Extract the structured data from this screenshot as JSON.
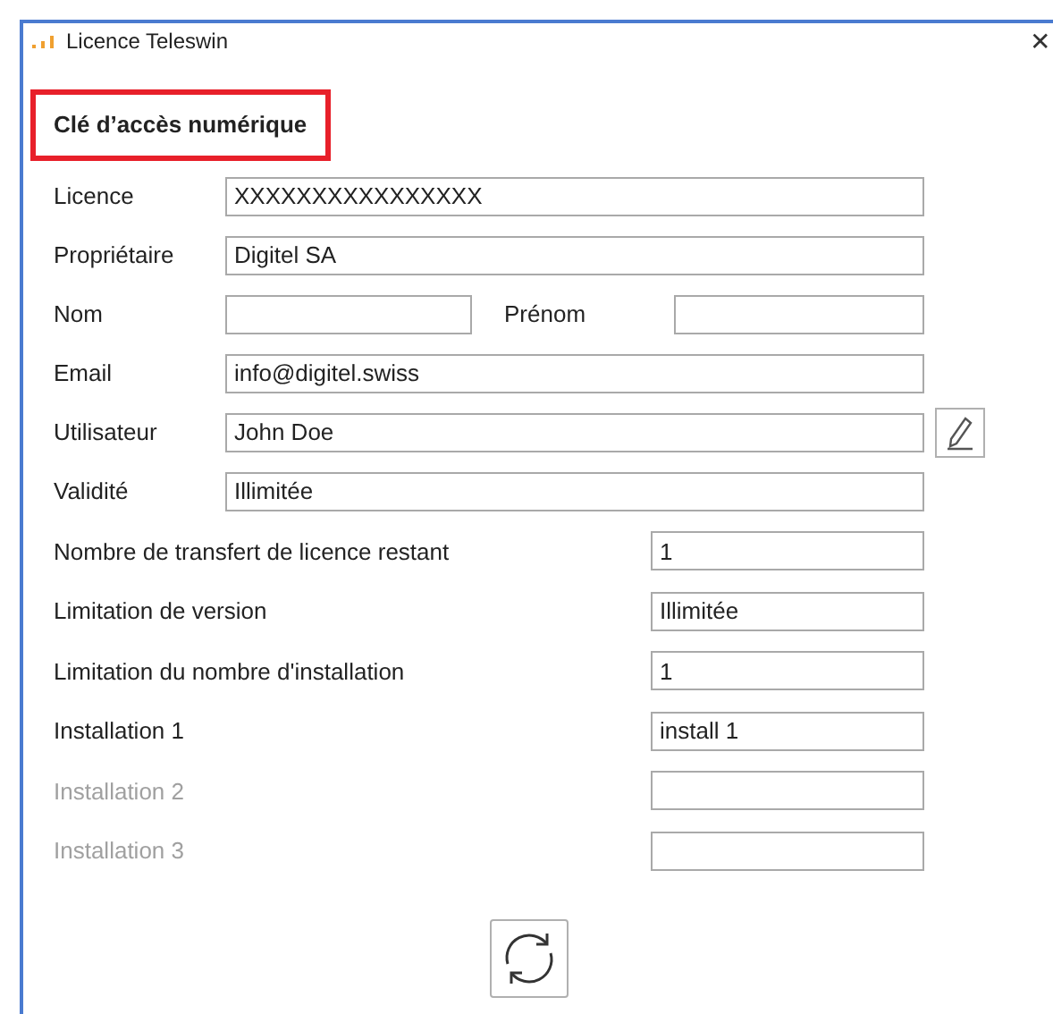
{
  "window": {
    "title": "Licence Teleswin",
    "close": "✕"
  },
  "heading": "Clé d’accès numérique",
  "fields": [
    {
      "kind": "text",
      "label": "Licence",
      "value": "XXXXXXXXXXXXXXXX"
    },
    {
      "kind": "text",
      "label": "Propriétaire",
      "value": "Digitel SA"
    },
    {
      "kind": "pair",
      "label": "Nom",
      "second_label": "Prénom"
    },
    {
      "kind": "text",
      "label": "Email",
      "value": "info@digitel.swiss"
    },
    {
      "kind": "editable",
      "label": "Utilisateur",
      "value": "John Doe"
    },
    {
      "kind": "text",
      "label": "Validité",
      "value": "Illimitée"
    }
  ],
  "details": [
    {
      "label": "Nombre de transfert de licence restant",
      "value": "1",
      "disabled": false
    },
    {
      "label": "Limitation de version",
      "value": "Illimitée",
      "disabled": false
    },
    {
      "label": "Limitation du nombre d'installation",
      "value": "1",
      "disabled": false
    },
    {
      "label": "Installation 1",
      "value": "install 1",
      "disabled": false
    },
    {
      "label": "Installation 2",
      "disabled": true
    },
    {
      "label": "Installation 3",
      "disabled": true
    }
  ]
}
